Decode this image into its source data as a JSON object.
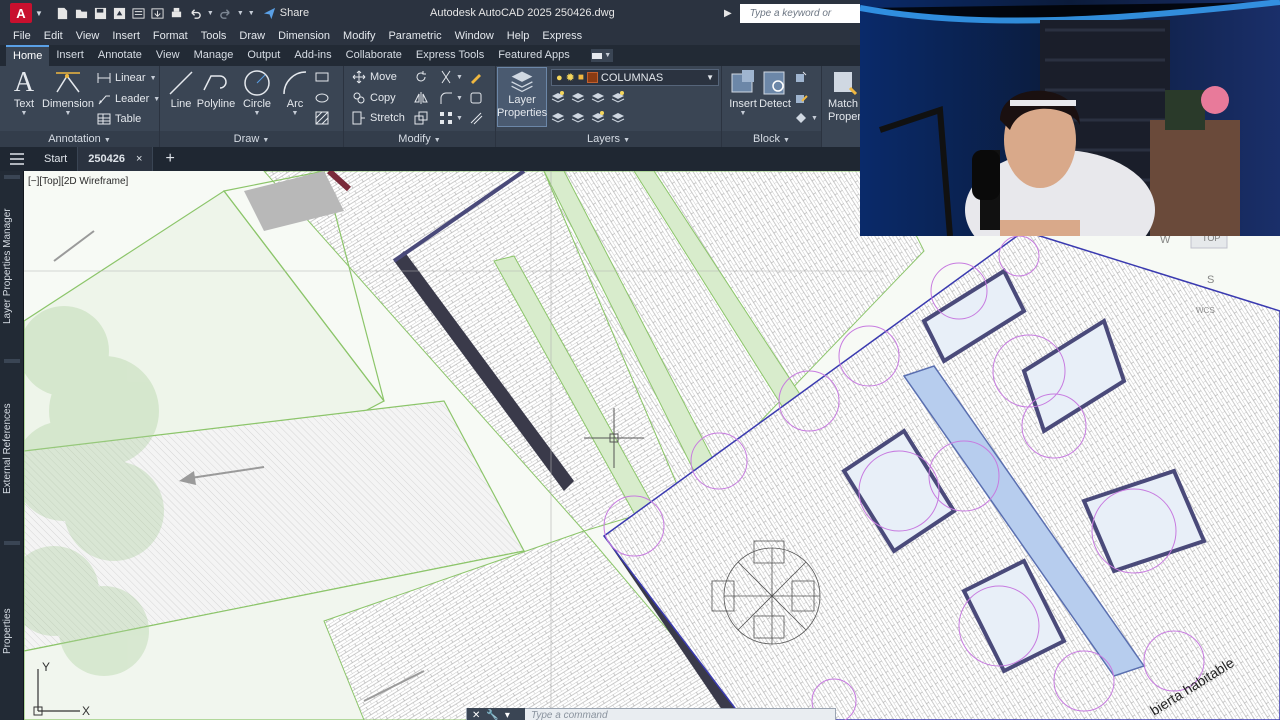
{
  "app": {
    "logo_letter": "A",
    "window_title": "Autodesk AutoCAD 2025   250426.dwg",
    "share_label": "Share",
    "search_placeholder": "Type a keyword or phrase"
  },
  "menu": [
    "File",
    "Edit",
    "View",
    "Insert",
    "Format",
    "Tools",
    "Draw",
    "Dimension",
    "Modify",
    "Parametric",
    "Window",
    "Help",
    "Express"
  ],
  "ribbon_tabs": [
    "Home",
    "Insert",
    "Annotate",
    "View",
    "Manage",
    "Output",
    "Add-ins",
    "Collaborate",
    "Express Tools",
    "Featured Apps"
  ],
  "ribbon_active_tab": "Home",
  "panels": {
    "annotation": {
      "title": "Annotation",
      "text_label": "Text",
      "dimension_label": "Dimension",
      "linear_label": "Linear",
      "leader_label": "Leader",
      "table_label": "Table"
    },
    "draw": {
      "title": "Draw",
      "line_label": "Line",
      "polyline_label": "Polyline",
      "circle_label": "Circle",
      "arc_label": "Arc"
    },
    "modify": {
      "title": "Modify",
      "move_label": "Move",
      "copy_label": "Copy",
      "stretch_label": "Stretch"
    },
    "layers": {
      "title": "Layers",
      "layer_properties_line1": "Layer",
      "layer_properties_line2": "Properties",
      "current_layer": "COLUMNAS"
    },
    "block": {
      "title": "Block",
      "insert_label": "Insert",
      "detect_label": "Detect",
      "match_line1": "Match",
      "match_line2": "Propert"
    }
  },
  "file_tabs": {
    "start_label": "Start",
    "drawing_label": "250426",
    "close_glyph": "×",
    "new_tab_glyph": "+"
  },
  "palettes": {
    "layer_properties_manager": "Layer Properties Manager",
    "external_references": "External References",
    "properties": "Properties"
  },
  "viewport": {
    "label": "[−][Top][2D Wireframe]",
    "ucs_y": "Y",
    "ucs_x": "X",
    "viewcube_top": "TOP",
    "viewcube_south": "S",
    "viewcube_west": "W",
    "wcs_label": "WCS",
    "drawing_text": "bierta habitable"
  },
  "command_line": {
    "placeholder": "Type a command"
  },
  "colors": {
    "ribbon_bg": "#3a4554",
    "title_bg": "#2b3340",
    "accent": "#5aa0e6",
    "autodesk_red": "#c8102e",
    "canvas_bg": "#f8faf7",
    "hatch_green": "#8cc56a",
    "tree_purple": "#c77be0",
    "pool_blue": "#b7cdee",
    "wall_dark": "#3a3a4a"
  }
}
